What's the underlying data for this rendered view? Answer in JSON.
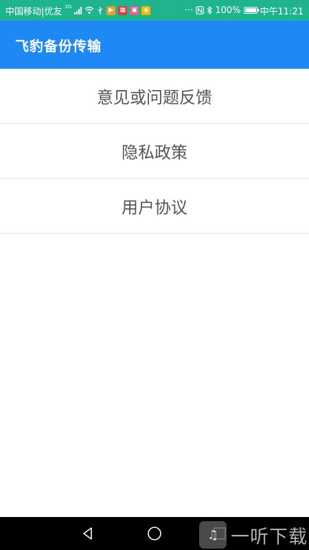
{
  "status_bar": {
    "carrier": "中国移动|优友",
    "network_badge": "2G",
    "battery": "100%",
    "time": "中午11:21",
    "more": "···",
    "bg_color": "#1fb38f"
  },
  "app_bar": {
    "title": "飞豹备份传输",
    "bg_color": "#1e88f5"
  },
  "menu": {
    "items": [
      {
        "label": "意见或问题反馈"
      },
      {
        "label": "隐私政策"
      },
      {
        "label": "用户协议"
      }
    ]
  },
  "nav_bar": {
    "icons": [
      "back-triangle-icon",
      "home-circle-icon",
      "recents-square-icon"
    ]
  },
  "watermark": {
    "text": "一听下载"
  }
}
